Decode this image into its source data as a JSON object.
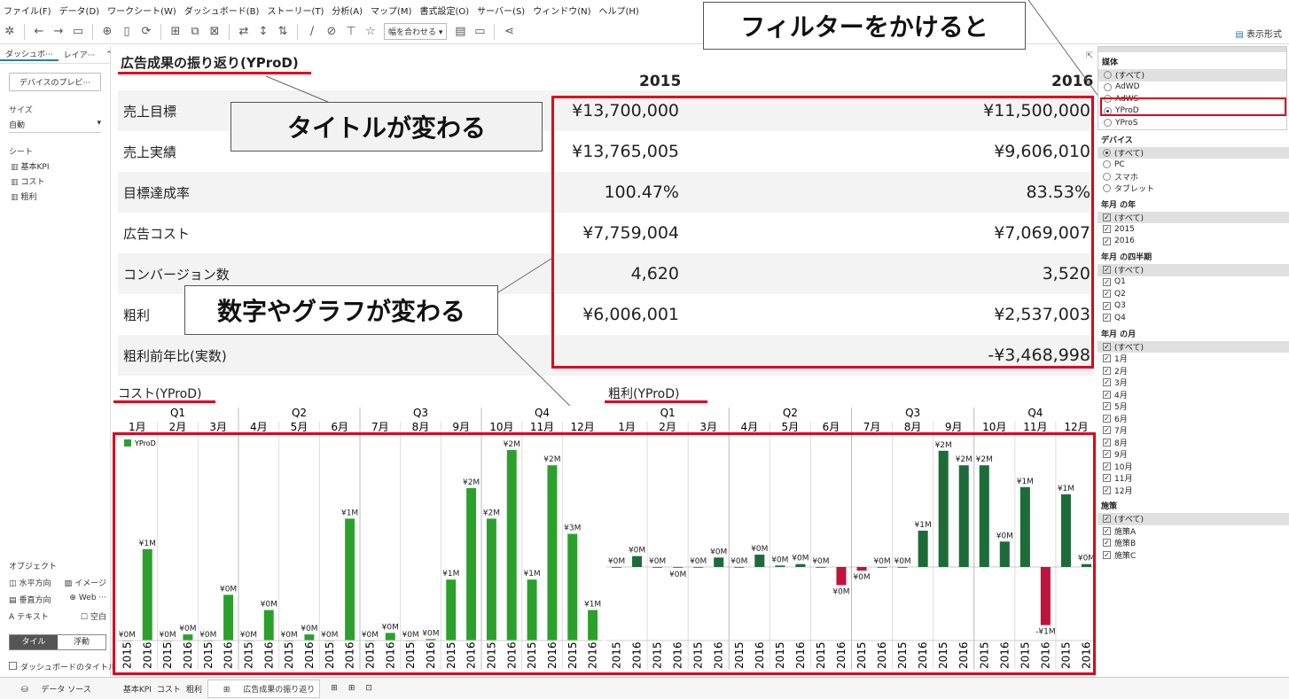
{
  "menu": [
    "ファイル(F)",
    "データ(D)",
    "ワークシート(W)",
    "ダッシュボード(B)",
    "ストーリー(T)",
    "分析(A)",
    "マップ(M)",
    "書式設定(O)",
    "サーバー(S)",
    "ウィンドウ(N)",
    "ヘルプ(H)"
  ],
  "toolbar": {
    "fit_label": "幅を合わせる",
    "show_me": "表示形式"
  },
  "callouts": {
    "filter": "フィルターをかけると",
    "title": "タイトルが変わる",
    "numbers": "数字やグラフが変わる"
  },
  "left": {
    "tab1": "ダッシュボ···",
    "tab2": "レイア···",
    "device_preview": "デバイスのプレビ···",
    "size_label": "サイズ",
    "size_value": "自動",
    "sheets_label": "シート",
    "sheets": [
      "基本KPI",
      "コスト",
      "粗利"
    ],
    "objects_label": "オブジェクト",
    "objects": [
      [
        "水平方向",
        "イメージ"
      ],
      [
        "垂直方向",
        "Web ···"
      ],
      [
        "テキスト",
        "空白"
      ]
    ],
    "tile": "タイル",
    "float": "浮動",
    "dash_title": "ダッシュボードのタイトル"
  },
  "bottom": {
    "datasource": "データ ソース",
    "tabs": [
      "基本KPI",
      "コスト",
      "粗利",
      "広告成果の振り返り"
    ]
  },
  "kpi": {
    "title": "広告成果の振り返り(YProD)",
    "years": [
      "2015",
      "2016"
    ],
    "rows": [
      {
        "label": "売上目標",
        "v2015": "¥13,700,000",
        "v2016": "¥11,500,000"
      },
      {
        "label": "売上実績",
        "v2015": "¥13,765,005",
        "v2016": "¥9,606,010"
      },
      {
        "label": "目標達成率",
        "v2015": "100.47%",
        "v2016": "83.53%"
      },
      {
        "label": "広告コスト",
        "v2015": "¥7,759,004",
        "v2016": "¥7,069,007"
      },
      {
        "label": "コンバージョン数",
        "v2015": "4,620",
        "v2016": "3,520"
      },
      {
        "label": "粗利",
        "v2015": "¥6,006,001",
        "v2016": "¥2,537,003"
      },
      {
        "label": "粗利前年比(実数)",
        "v2015": "",
        "v2016": "-¥3,468,998"
      }
    ]
  },
  "filters": {
    "media": {
      "title": "媒体",
      "items": [
        "(すべて)",
        "AdWD",
        "AdWS",
        "YProD",
        "YProS"
      ],
      "selected": 3
    },
    "device": {
      "title": "デバイス",
      "items": [
        "(すべて)",
        "PC",
        "スマホ",
        "タブレット"
      ],
      "selected": 0
    },
    "year": {
      "title": "年月 の年",
      "items": [
        "(すべて)",
        "2015",
        "2016"
      ]
    },
    "quarter": {
      "title": "年月 の四半期",
      "items": [
        "(すべて)",
        "Q1",
        "Q2",
        "Q3",
        "Q4"
      ]
    },
    "month": {
      "title": "年月 の月",
      "items": [
        "(すべて)",
        "1月",
        "2月",
        "3月",
        "4月",
        "5月",
        "6月",
        "7月",
        "8月",
        "9月",
        "10月",
        "11月",
        "12月"
      ]
    },
    "measure": {
      "title": "施策",
      "items": [
        "(すべて)",
        "施策A",
        "施策B",
        "施策C"
      ]
    }
  },
  "colors": {
    "cost_bar": "#2ca02c",
    "profit_pos": "#1e6b3a",
    "profit_neg": "#c0143c",
    "highlight": "#e0001b"
  },
  "chart_data": [
    {
      "type": "bar",
      "title": "コスト(YProD)",
      "quarters": [
        "Q1",
        "Q2",
        "Q3",
        "Q4"
      ],
      "months": [
        "1月",
        "2月",
        "3月",
        "4月",
        "5月",
        "6月",
        "7月",
        "8月",
        "9月",
        "10月",
        "11月",
        "12月"
      ],
      "years": [
        "2015",
        "2016"
      ],
      "legend": "YProD",
      "values": [
        [
          0,
          1.2
        ],
        [
          0,
          0.08
        ],
        [
          0,
          0.6
        ],
        [
          0,
          0.4
        ],
        [
          0,
          0.08
        ],
        [
          0,
          1.6
        ],
        [
          0,
          0.1
        ],
        [
          0,
          0.02
        ],
        [
          0.8,
          2.0
        ],
        [
          1.6,
          2.5
        ],
        [
          0.8,
          2.3
        ],
        [
          1.4,
          0.4
        ]
      ],
      "labels": [
        [
          "¥0M",
          "¥1M"
        ],
        [
          "¥0M",
          "¥0M"
        ],
        [
          "¥0M",
          "¥0M"
        ],
        [
          "¥0M",
          "¥0M"
        ],
        [
          "¥0M",
          "¥0M"
        ],
        [
          "¥0M",
          "¥1M"
        ],
        [
          "¥0M",
          "¥0M"
        ],
        [
          "¥0M",
          "¥0M"
        ],
        [
          "¥1M",
          "¥2M"
        ],
        [
          "¥2M",
          "¥2M"
        ],
        [
          "¥1M",
          "¥2M"
        ],
        [
          "¥3M",
          "¥1M"
        ]
      ]
    },
    {
      "type": "bar",
      "title": "粗利(YProD)",
      "quarters": [
        "Q1",
        "Q2",
        "Q3",
        "Q4"
      ],
      "months": [
        "1月",
        "2月",
        "3月",
        "4月",
        "5月",
        "6月",
        "7月",
        "8月",
        "9月",
        "10月",
        "11月",
        "12月"
      ],
      "years": [
        "2015",
        "2016"
      ],
      "values": [
        [
          0,
          0.15
        ],
        [
          0,
          -0.01
        ],
        [
          0,
          0.13
        ],
        [
          0,
          0.17
        ],
        [
          0.02,
          0.04
        ],
        [
          0,
          -0.25
        ],
        [
          -0.05,
          0
        ],
        [
          0,
          0.5
        ],
        [
          1.6,
          1.4
        ],
        [
          1.4,
          0.35
        ],
        [
          1.1,
          -0.8
        ],
        [
          1.0,
          0.04
        ]
      ],
      "labels": [
        [
          "¥0M",
          "¥0M"
        ],
        [
          "¥0M",
          "¥0M"
        ],
        [
          "¥0M",
          "¥0M"
        ],
        [
          "¥0M",
          "¥0M"
        ],
        [
          "¥0M",
          "¥0M"
        ],
        [
          "¥0M",
          "¥0M"
        ],
        [
          "¥0M",
          "¥0M"
        ],
        [
          "¥0M",
          "¥1M"
        ],
        [
          "¥2M",
          "¥2M"
        ],
        [
          "¥2M",
          "¥0M"
        ],
        [
          "¥1M",
          "-¥1M"
        ],
        [
          "¥1M",
          "¥0M"
        ]
      ]
    }
  ]
}
